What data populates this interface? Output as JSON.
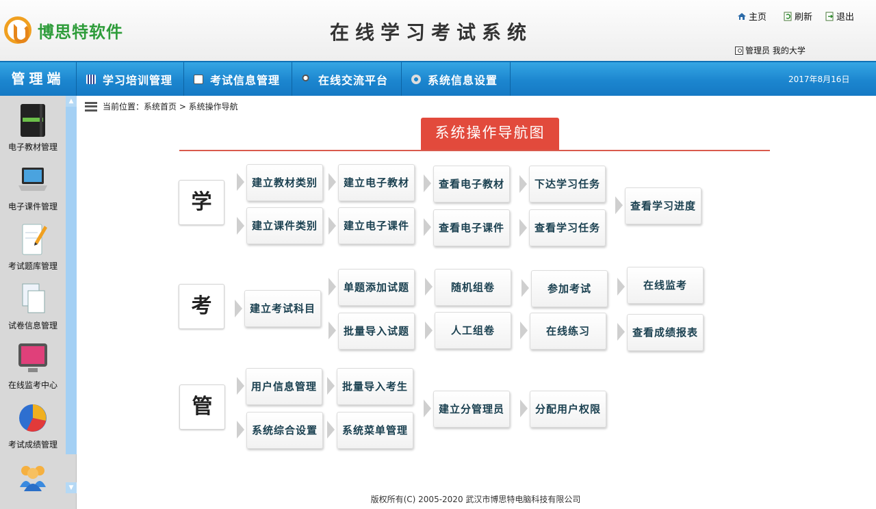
{
  "header": {
    "brand": "博思特软件",
    "title": "在线学习考试系统",
    "links": {
      "home": "主页",
      "refresh": "刷新",
      "logout": "退出"
    },
    "user": "管理员 我的大学"
  },
  "nav": {
    "brand": "管理端",
    "items": [
      "学习培训管理",
      "考试信息管理",
      "在线交流平台",
      "系统信息设置"
    ],
    "date": "2017年8月16日"
  },
  "sidebar": {
    "items": [
      "电子教材管理",
      "电子课件管理",
      "考试题库管理",
      "试卷信息管理",
      "在线监考中心",
      "考试成绩管理"
    ]
  },
  "breadcrumb": "当前位置：系统首页 > 系统操作导航",
  "map": {
    "title": "系统操作导航图",
    "categories": {
      "learn": "学",
      "exam": "考",
      "manage": "管"
    },
    "learn": {
      "b1": "建立教材类别",
      "b2": "建立课件类别",
      "b3": "建立电子教材",
      "b4": "建立电子课件",
      "b5": "查看电子教材",
      "b6": "查看电子课件",
      "b7": "下达学习任务",
      "b8": "查看学习任务",
      "b9": "查看学习进度"
    },
    "exam": {
      "b1": "建立考试科目",
      "b2": "单题添加试题",
      "b3": "批量导入试题",
      "b4": "随机组卷",
      "b5": "人工组卷",
      "b6": "参加考试",
      "b7": "在线练习",
      "b8": "在线监考",
      "b9": "查看成绩报表"
    },
    "manage": {
      "b1": "用户信息管理",
      "b2": "系统综合设置",
      "b3": "批量导入考生",
      "b4": "系统菜单管理",
      "b5": "建立分管理员",
      "b6": "分配用户权限"
    }
  },
  "footer": "版权所有(C) 2005-2020 武汉市博思特电脑科技有限公司",
  "colors": {
    "nav": "#1c86cf",
    "title_badge": "#e24a3c",
    "brand_green": "#2e9c3a"
  }
}
